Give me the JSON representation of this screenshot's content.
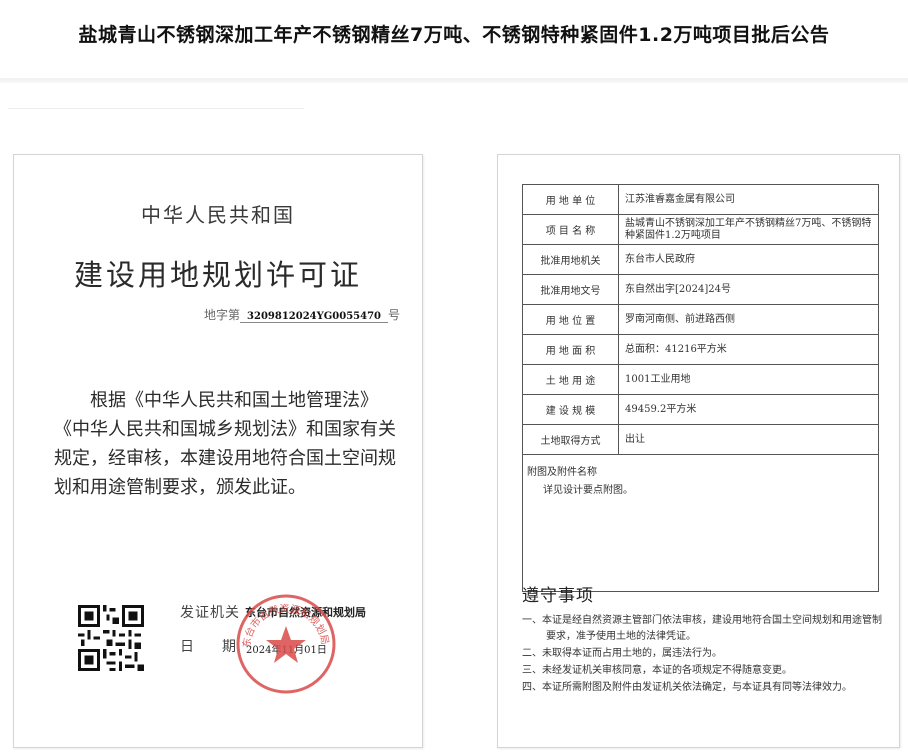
{
  "page": {
    "title": "盐城青山不锈钢深加工年产不锈钢精丝7万吨、不锈钢特种紧固件1.2万吨项目批后公告"
  },
  "certificate": {
    "country": "中华人民共和国",
    "title": "建设用地规划许可证",
    "number_prefix": "地字第",
    "number": "3209812024YG0055470",
    "number_suffix": "号",
    "body": "根据《中华人民共和国土地管理法》《中华人民共和国城乡规划法》和国家有关规定，经审核，本建设用地符合国土空间规划和用途管制要求，颁发此证。",
    "issuer_label": "发证机关",
    "issuer": "东台市自然资源和规划局",
    "date_label": "日期",
    "date": "2024年11月01日",
    "seal_text": "东台市自然资源和规划局行政审批专用章"
  },
  "details": {
    "rows": [
      {
        "label": "用 地 单 位",
        "value": "江苏淮睿嘉金属有限公司"
      },
      {
        "label": "项 目 名 称",
        "value": "盐城青山不锈钢深加工年产不锈钢精丝7万吨、不锈钢特种紧固件1.2万吨项目"
      },
      {
        "label": "批准用地机关",
        "value": "东台市人民政府"
      },
      {
        "label": "批准用地文号",
        "value": "东自然出字[2024]24号"
      },
      {
        "label": "用 地 位 置",
        "value": "罗南河南侧、前进路西侧"
      },
      {
        "label": "用 地 面 积",
        "value": "总面积：41216平方米"
      },
      {
        "label": "土 地 用 途",
        "value": "1001工业用地"
      },
      {
        "label": "建 设 规 模",
        "value": "49459.2平方米"
      },
      {
        "label": "土地取得方式",
        "value": "出让"
      }
    ],
    "attachments_title": "附图及附件名称",
    "attachments_value": "详见设计要点附图。"
  },
  "notice": {
    "title": "遵守事项",
    "items": [
      "一、本证是经自然资源主管部门依法审核，建设用地符合国土空间规划和用途管制要求，准予使用土地的法律凭证。",
      "二、未取得本证而占用土地的，属违法行为。",
      "三、未经发证机关审核同意，本证的各项规定不得随意变更。",
      "四、本证所需附图及附件由发证机关依法确定，与本证具有同等法律效力。"
    ]
  },
  "colors": {
    "seal_red": "#d94a4a",
    "border": "#d4d4d4"
  }
}
